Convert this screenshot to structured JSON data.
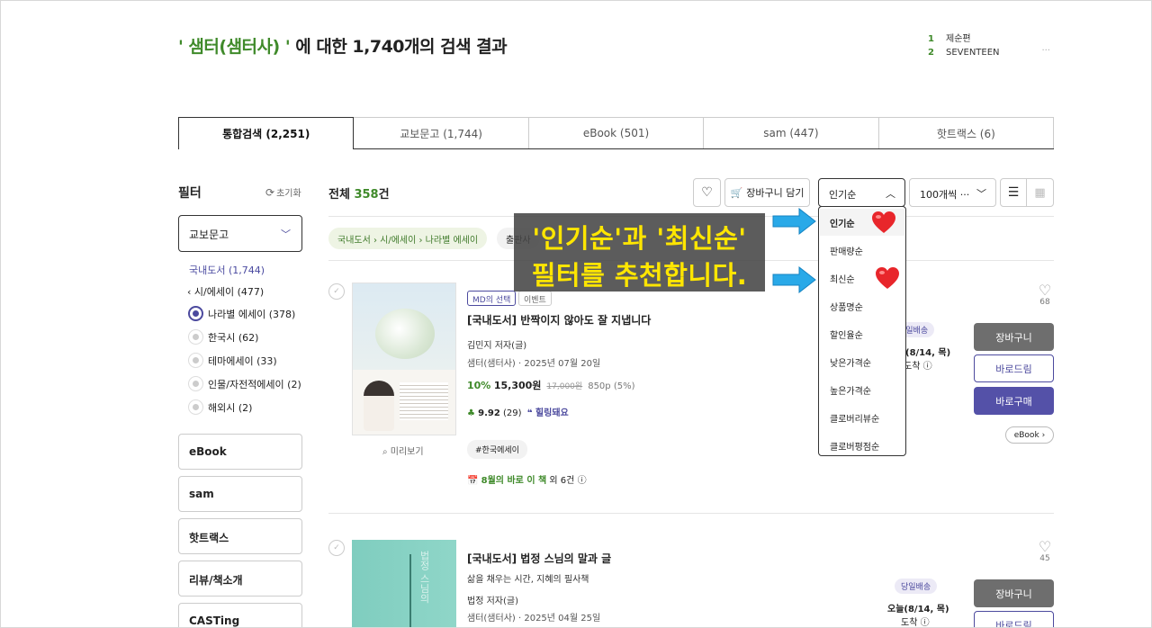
{
  "header": {
    "result_keyword": "' 샘터(샘터사) '",
    "result_suffix": " 에 대한 1,740개의 검색 결과",
    "rank1_num": "1",
    "rank1_text": "제순편",
    "rank2_num": "2",
    "rank2_text": "SEVENTEEN"
  },
  "tabs": [
    "통합검색 (2,251)",
    "교보문고 (1,744)",
    "eBook (501)",
    "sam (447)",
    "핫트랙스 (6)"
  ],
  "sidebar": {
    "filter_title": "필터",
    "reset_label": "초기화",
    "kyobo_label": "교보문고",
    "domestic_label": "국내도서 (1,744)",
    "poetry_label": "시/에세이 (477)",
    "options": [
      "나라별 에세이 (378)",
      "한국시 (62)",
      "테마에세이 (33)",
      "인물/자전적에세이 (2)",
      "해외시 (2)"
    ],
    "sections": [
      "eBook",
      "sam",
      "핫트랙스",
      "리뷰/책소개",
      "CASTing"
    ]
  },
  "toolbar": {
    "total_prefix": "전체 ",
    "total_count": "358",
    "total_suffix": "건",
    "cart_label": "장바구니 담기",
    "sort_label": "인기순",
    "count_label": "100개씩 ···"
  },
  "breadcrumb": {
    "path": "국내도서 › 시/에세이 › 나라별 에세이",
    "publisher_tag": "출판사"
  },
  "sort_options": [
    "인기순",
    "판매량순",
    "최신순",
    "상품명순",
    "할인율순",
    "낮은가격순",
    "높은가격순",
    "클로버리뷰순",
    "클로버평점순"
  ],
  "overlay": {
    "line1": "'인기순'과 '최신순'",
    "line2": "필터를 추천합니다."
  },
  "book1": {
    "badge_md": "MD의 선택",
    "badge_event": "이벤트",
    "title": "[국내도서] 반짝이지 않아도 잘 지냅니다",
    "author": "김민지 저자(글)",
    "publisher": "샘터(샘터사) · 2025년 07월 20일",
    "discount": "10%",
    "price": "15,300원",
    "orig_price": "17,000원",
    "points": "850p (5%)",
    "rating": "9.92",
    "rating_count": "(29)",
    "review_kw": "힐링돼요",
    "hashtag": "#한국에세이",
    "monthly_green": "8월의 바로 이 책",
    "monthly_rest": " 외 6건",
    "preview": "미리보기",
    "wish_count": "68",
    "sameday": "당일배송",
    "arrive1": "(8/14, 목)",
    "arrive2": "도착",
    "cart": "장바구니",
    "gift": "바로드림",
    "buy": "바로구매",
    "ebook": "eBook"
  },
  "book2": {
    "title": "[국내도서] 법정 스님의 말과 글",
    "subtitle": "삶을 채우는 시간, 지혜의 필사책",
    "author": "법정 저자(글)",
    "publisher": "샘터(샘터사) · 2025년 04월 25일",
    "wish_count": "45",
    "sameday": "당일배송",
    "arrive1": "오늘(8/14, 목)",
    "arrive2": "도착",
    "cart": "장바구니",
    "gift": "바로드림",
    "cover_text": "법정 스님의"
  },
  "colors": {
    "accent_green": "#3f8a2a",
    "accent_purple": "#5451a8",
    "overlay_text": "#ffe600",
    "arrow": "#29a9e8",
    "heart": "#e8262b"
  }
}
